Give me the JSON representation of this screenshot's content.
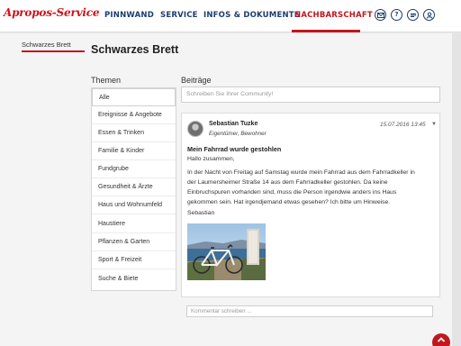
{
  "app": {
    "logo_text": "Apropos-Service"
  },
  "nav": {
    "items": [
      {
        "label": "PINNWAND"
      },
      {
        "label": "SERVICE"
      },
      {
        "label": "INFOS & DOKUMENTE"
      },
      {
        "label": "NACHBARSCHAFT"
      }
    ],
    "active": "NACHBARSCHAFT",
    "icons": [
      "mail-icon",
      "help-icon",
      "chat-icon",
      "user-icon"
    ]
  },
  "breadcrumb": "Schwarzes Brett",
  "page_title": "Schwarzes Brett",
  "topics": {
    "heading": "Themen",
    "items": [
      {
        "label": "Alle"
      },
      {
        "label": "Ereignisse & Angebote"
      },
      {
        "label": "Essen & Trinken"
      },
      {
        "label": "Familie & Kinder"
      },
      {
        "label": "Fundgrube"
      },
      {
        "label": "Gesundheit & Ärzte"
      },
      {
        "label": "Haus und Wohnumfeld"
      },
      {
        "label": "Haustiere"
      },
      {
        "label": "Pflanzen & Garten"
      },
      {
        "label": "Sport & Freizeit"
      },
      {
        "label": "Suche & Biete"
      }
    ]
  },
  "posts_section": {
    "heading": "Beiträge",
    "composer_placeholder": "Schreiben Sie Ihrer Community!"
  },
  "post": {
    "author": "Sebastian Tuzke",
    "role": "Eigentümer, Bewohner",
    "timestamp": "15.07.2016 13:45",
    "title": "Mein Fahrrad wurde gestohlen",
    "greeting": "Hallo zusammen,",
    "body_lines": [
      "In der Nacht von Freitag auf Samstag wurde mein Fahrrad aus dem Fahrradkeller in",
      "der Laumersheimer Straße 14 aus dem Fahrradkeller gestohlen. Da keine",
      "Einbruchspuren vorhanden sind, muss die Person irgendwie anders ins Haus",
      "gekommen sein. Hat irgendjemand etwas gesehen? Ich bitte um Hinweise."
    ],
    "signature": "Sebastian",
    "comment_placeholder": "Kommentar schreiben ..."
  },
  "colors": {
    "brand_red": "#c0181d",
    "nav_blue": "#1d3c6e",
    "page_bg": "#f4f4f4"
  }
}
